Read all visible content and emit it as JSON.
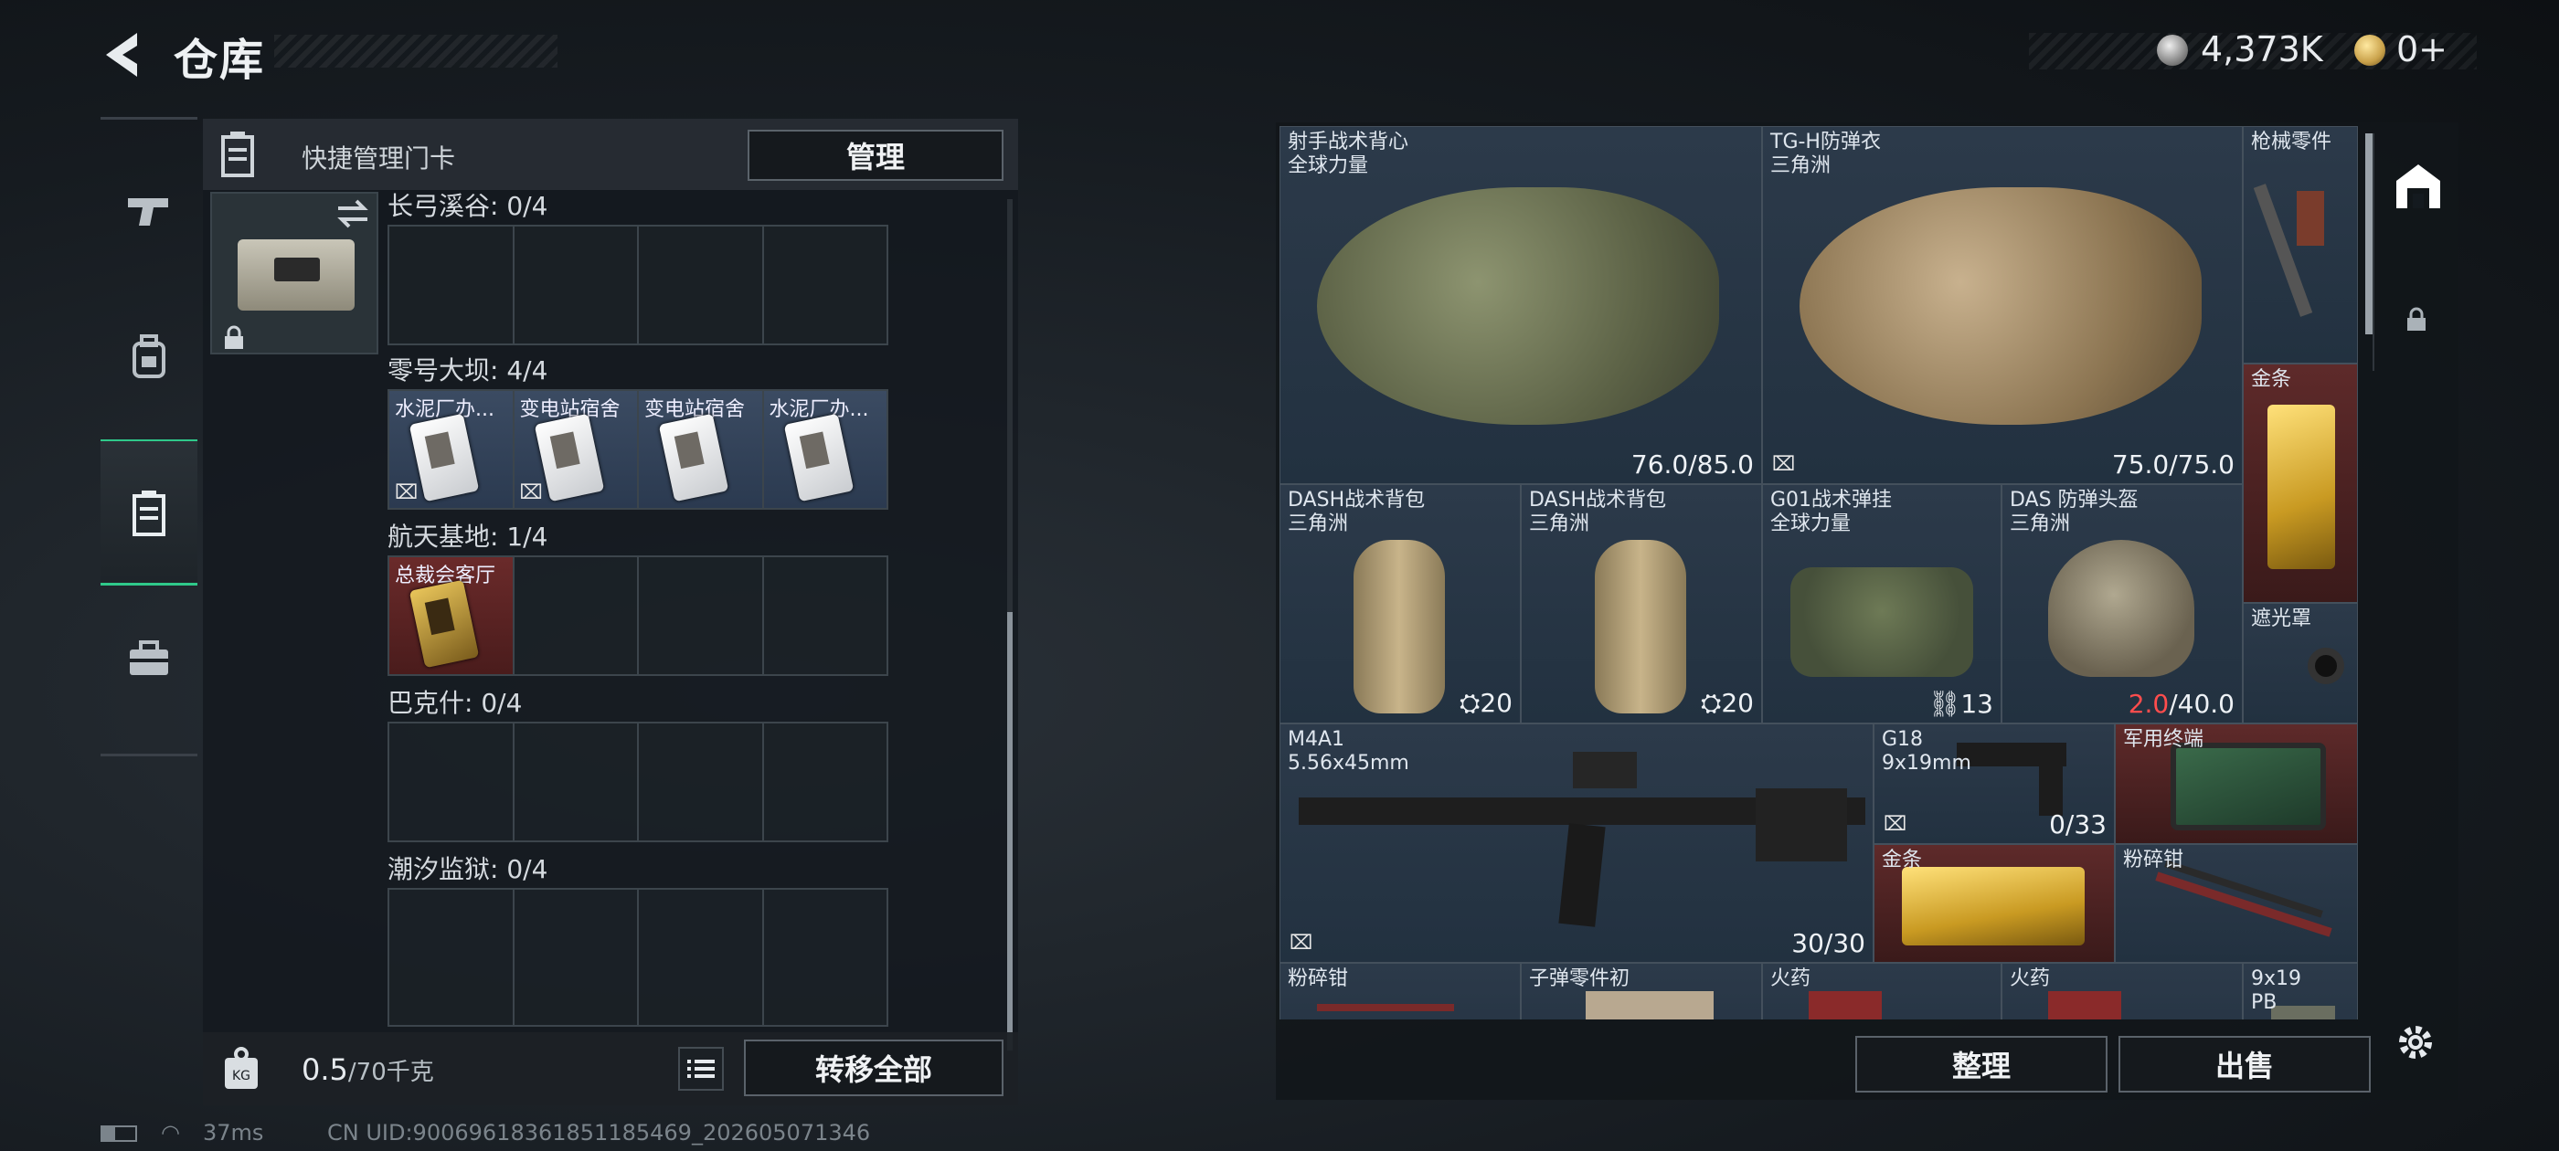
{
  "header": {
    "title": "仓库",
    "currency_silver": "4,373K",
    "currency_gold": "0+"
  },
  "left_panel": {
    "header_title": "快捷管理门卡",
    "manage_label": "管理",
    "maps": [
      {
        "label": "长弓溪谷: 0/4",
        "cards": []
      },
      {
        "label": "零号大坝: 4/4",
        "cards": [
          "水泥厂办...",
          "变电站宿舍",
          "变电站宿舍",
          "水泥厂办..."
        ]
      },
      {
        "label": "航天基地: 1/4",
        "cards": [
          "总裁会客厅"
        ]
      },
      {
        "label": "巴克什: 0/4",
        "cards": []
      },
      {
        "label": "潮汐监狱: 0/4",
        "cards": []
      }
    ],
    "weight_value": "0.5",
    "weight_max": "/70千克",
    "transfer_all_label": "转移全部"
  },
  "stash": {
    "items": [
      {
        "name": "射手战术背心",
        "sub": "全球力量",
        "value": "76.0/85.0"
      },
      {
        "name": "TG-H防弹衣",
        "sub": "三角洲",
        "value": "75.0/75.0"
      },
      {
        "name": "枪械零件",
        "sub": "",
        "value": ""
      },
      {
        "name": "金条",
        "sub": "",
        "value": ""
      },
      {
        "name": "DASH战术背包",
        "sub": "三角洲",
        "value": "20"
      },
      {
        "name": "DASH战术背包",
        "sub": "三角洲",
        "value": "20"
      },
      {
        "name": "G01战术弹挂",
        "sub": "全球力量",
        "value": "13"
      },
      {
        "name": "DAS 防弹头盔",
        "sub": "三角洲",
        "value_low": "2.0",
        "value_max": "/40.0"
      },
      {
        "name": "遮光罩",
        "sub": "",
        "value": ""
      },
      {
        "name": "M4A1",
        "sub": "5.56x45mm",
        "value": "30/30"
      },
      {
        "name": "G18",
        "sub": "9x19mm",
        "value": "0/33"
      },
      {
        "name": "军用终端",
        "sub": "",
        "value": ""
      },
      {
        "name": "金条",
        "sub": "",
        "value": ""
      },
      {
        "name": "粉碎钳",
        "sub": "",
        "value": ""
      },
      {
        "name": "粉碎钳",
        "sub": "",
        "value": ""
      },
      {
        "name": "子弹零件初",
        "sub": "",
        "value": ""
      },
      {
        "name": "火药",
        "sub": "",
        "value": ""
      },
      {
        "name": "火药",
        "sub": "",
        "value": ""
      },
      {
        "name": "9x19",
        "sub": "PB",
        "value": ""
      }
    ],
    "sort_label": "整理",
    "sell_label": "出售"
  },
  "status_bar": {
    "ping": "37ms",
    "uid": "CN UID:9006961836185118546​9_202605071346"
  },
  "colors": {
    "accent_green": "#2fc98a",
    "cell_blue": "#2c3a4a",
    "cell_red": "#5e2a2a",
    "low_value_red": "#ff4d4d"
  }
}
